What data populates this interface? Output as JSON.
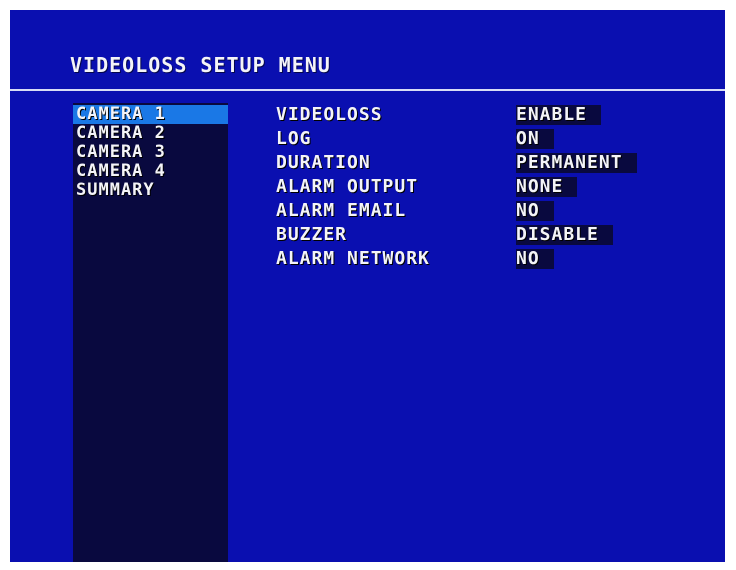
{
  "menu": {
    "title": "VIDEOLOSS SETUP MENU"
  },
  "sidebar": {
    "items": [
      {
        "label": "CAMERA 1",
        "selected": true
      },
      {
        "label": "CAMERA 2",
        "selected": false
      },
      {
        "label": "CAMERA 3",
        "selected": false
      },
      {
        "label": "CAMERA 4",
        "selected": false
      },
      {
        "label": "SUMMARY",
        "selected": false
      }
    ]
  },
  "settings": [
    {
      "label": "VIDEOLOSS",
      "value": "ENABLE"
    },
    {
      "label": "LOG",
      "value": "ON"
    },
    {
      "label": "DURATION",
      "value": "PERMANENT"
    },
    {
      "label": "ALARM OUTPUT",
      "value": "NONE"
    },
    {
      "label": "ALARM EMAIL",
      "value": "NO"
    },
    {
      "label": "BUZZER",
      "value": "DISABLE"
    },
    {
      "label": "ALARM NETWORK",
      "value": "NO"
    }
  ],
  "colors": {
    "background": "#0a0fb0",
    "sidebar_panel": "#09093f",
    "selection": "#1a78e6",
    "text": "#f4f4f8"
  }
}
